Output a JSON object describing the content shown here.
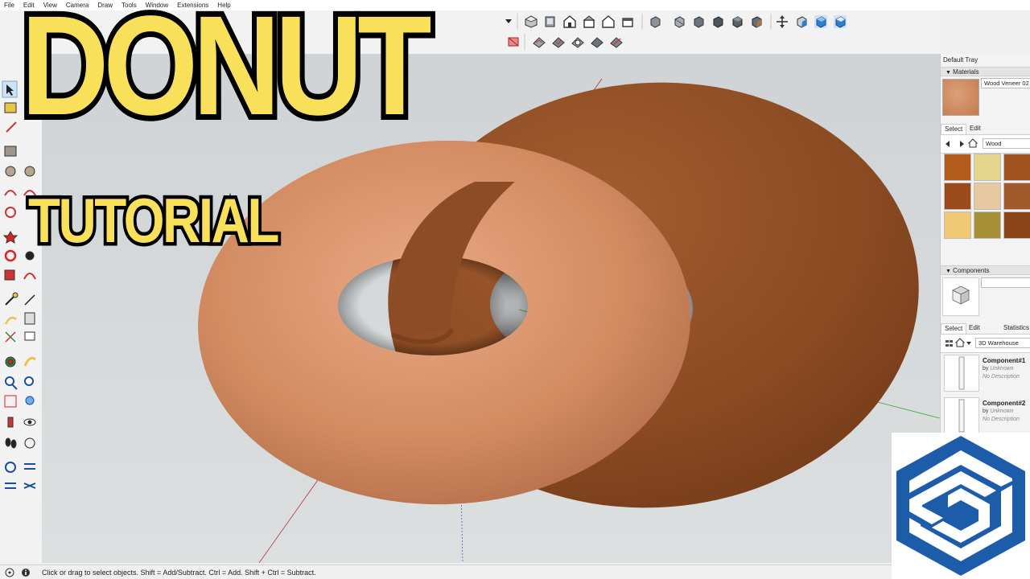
{
  "menu": [
    "File",
    "Edit",
    "View",
    "Camera",
    "Draw",
    "Tools",
    "Window",
    "Extensions",
    "Help"
  ],
  "overlay": {
    "title": "DONUT",
    "subtitle": "TUTORIAL"
  },
  "status": {
    "text": "Click or drag to select objects. Shift = Add/Subtract. Ctrl = Add. Shift + Ctrl = Subtract."
  },
  "tray": {
    "title": "Default Tray",
    "materials": {
      "header": "Materials",
      "current_name": "Wood Veneer 02",
      "tabs": [
        "Select",
        "Edit"
      ],
      "library": "Wood"
    },
    "components": {
      "header": "Components",
      "tabs": [
        "Select",
        "Edit",
        "Statistics"
      ],
      "search": "3D Warehouse",
      "items": [
        {
          "name": "Component#1",
          "by": "by",
          "author": "Unknown",
          "desc": "No Description"
        },
        {
          "name": "Component#2",
          "by": "by",
          "author": "Unknown",
          "desc": "No Description"
        }
      ]
    }
  },
  "colors": {
    "title_yellow": "#f9e05b",
    "logo_blue": "#1d5ca8",
    "donut_left": "#d59066",
    "donut_right": "#8b4a21"
  },
  "icons": {
    "tray_nav": [
      "back-icon",
      "forward-icon",
      "home-icon"
    ],
    "components_nav": [
      "display-options-icon",
      "home-icon",
      "dropdown-icon"
    ]
  }
}
